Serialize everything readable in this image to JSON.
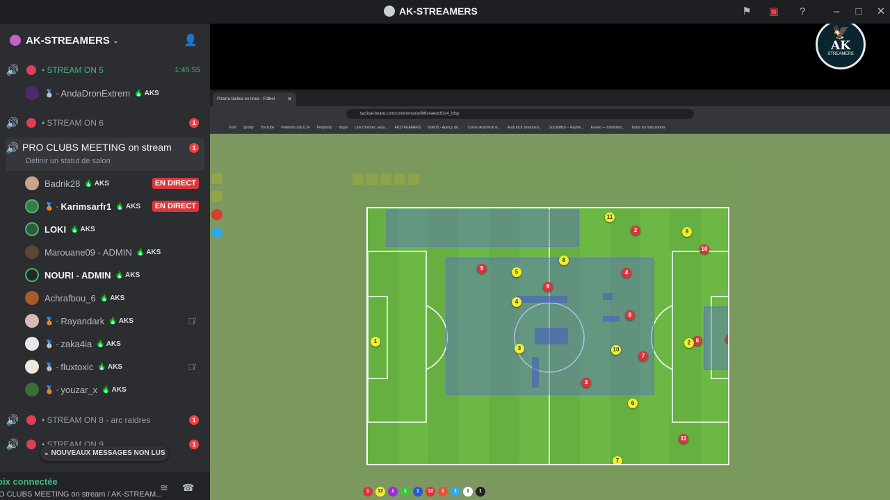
{
  "window": {
    "title": "AK-STREAMERS"
  },
  "server": {
    "name": "AK-STREAMERS"
  },
  "channels": [
    {
      "name": "STREAM ON 5",
      "time": "1:45:55",
      "live": true
    },
    {
      "name": "STREAM ON 6",
      "badge": "1"
    },
    {
      "name": "PRO CLUBS MEETING on stream",
      "badge": "1",
      "status": "Définir un statut de salon"
    },
    {
      "name": "STREAM ON 8 - arc raidres",
      "badge": "1"
    },
    {
      "name": "STREAM ON 9",
      "badge": "1"
    }
  ],
  "stream5_users": [
    {
      "name": "AndaDronExtrem",
      "tag": "AKS",
      "medal": "🥈 -"
    }
  ],
  "meeting_users": [
    {
      "name": "Badrik28",
      "tag": "AKS",
      "live": "EN DIRECT"
    },
    {
      "name": "Karimsarfr1",
      "tag": "AKS",
      "live": "EN DIRECT",
      "medal": "🥉 -"
    },
    {
      "name": "LOKI",
      "tag": "AKS"
    },
    {
      "name": "Marouane09 - ADMIN",
      "tag": "AKS"
    },
    {
      "name": "NOURI - ADMIN",
      "tag": "AKS"
    },
    {
      "name": "Achrafbou_6",
      "tag": "AKS"
    },
    {
      "name": "Rayandark",
      "tag": "AKS",
      "medal": "🥉 -"
    },
    {
      "name": "zaka4ia",
      "tag": "AKS",
      "medal": "🥈 -"
    },
    {
      "name": "fluxtoxic",
      "tag": "AKS",
      "medal": "🥈 -"
    },
    {
      "name": "youzar_x",
      "tag": "AKS",
      "medal": "🥉 -"
    }
  ],
  "new_messages": "NOUVEAUX MESSAGES NON LUS",
  "voice": {
    "status": "oix connectée",
    "channel": "O CLUBS MEETING on stream / AK-STREAM..."
  },
  "stream_logo": {
    "ak": "AK",
    "sub": "STREAMERS"
  },
  "browser": {
    "tab_title": "Pizarra táctica en línea - Fútbol",
    "url": "tactical-board.com/conference/a0b6c4aedc92c4_bfsp",
    "bookmarks": [
      "Kick",
      "Spotify",
      "YouTube",
      "Paletools v26.0.24",
      "Perplexity",
      "Imgur",
      "Link Checker: ¡esta...",
      "AKSTREAMERS",
      "IONOS - Aperçu de...",
      "Correo Arab Kick st...",
      "Arab Kick Streamers...",
      "SocialWick – Payme...",
      "Envato — Unlimited...",
      "Todos los marcadores"
    ]
  },
  "board": {
    "players_red": [
      "5",
      "2",
      "10",
      "4",
      "9",
      "8",
      "7",
      "3",
      "6",
      "1",
      "11"
    ],
    "players_yellow": [
      "11",
      "9",
      "5",
      "8",
      "4",
      "1",
      "3",
      "10",
      "2",
      "6",
      "7"
    ],
    "tokens": [
      "1",
      "12",
      "1",
      "1",
      "1",
      "12",
      "1",
      "1",
      "1",
      "1"
    ]
  }
}
